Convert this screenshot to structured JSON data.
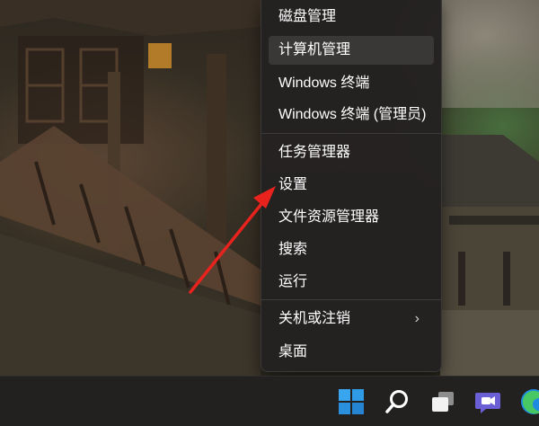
{
  "context_menu": {
    "items": [
      {
        "label": "磁盘管理"
      },
      {
        "label": "计算机管理"
      },
      {
        "label": "Windows 终端"
      },
      {
        "label": "Windows 终端 (管理员)"
      },
      {
        "label": "任务管理器"
      },
      {
        "label": "设置"
      },
      {
        "label": "文件资源管理器"
      },
      {
        "label": "搜索"
      },
      {
        "label": "运行"
      },
      {
        "label": "关机或注销",
        "submenu": true,
        "chevron": "›"
      },
      {
        "label": "桌面"
      }
    ],
    "highlighted": "计算机管理"
  },
  "taskbar": {
    "icons": [
      "windows-start-icon",
      "search-icon",
      "task-view-icon",
      "chat-icon",
      "edge-icon"
    ]
  },
  "annotation": {
    "arrow_color": "#e8231e",
    "points_to": "设置"
  }
}
